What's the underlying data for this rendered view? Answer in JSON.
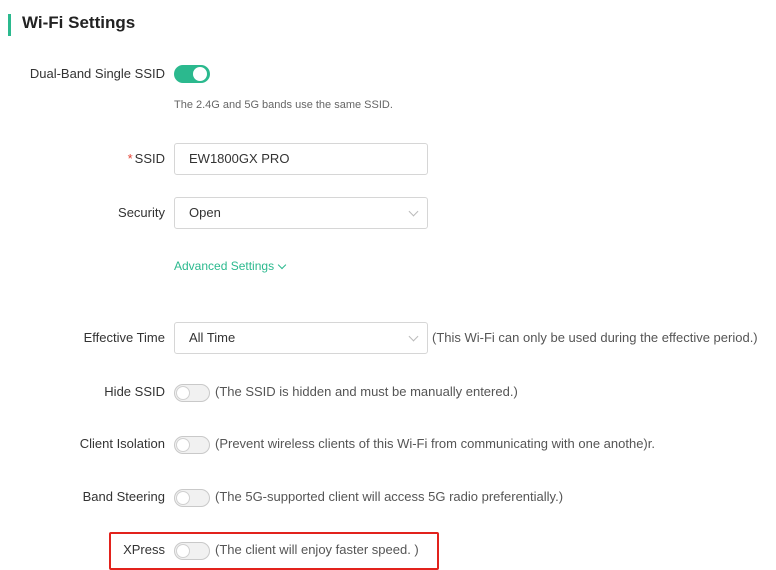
{
  "page": {
    "title": "Wi-Fi Settings",
    "accent_color": "#2bb98e",
    "highlight_color": "#e2221c"
  },
  "dual_band": {
    "label": "Dual-Band Single SSID",
    "enabled": true,
    "hint": "The 2.4G and 5G bands use the same SSID."
  },
  "ssid": {
    "required_mark": "*",
    "label": "SSID",
    "value": "EW1800GX PRO"
  },
  "security": {
    "label": "Security",
    "value": "Open"
  },
  "advanced": {
    "label": "Advanced Settings"
  },
  "effective_time": {
    "label": "Effective Time",
    "value": "All Time",
    "desc": "(This Wi-Fi can only be used during the effective period.)"
  },
  "hide_ssid": {
    "label": "Hide SSID",
    "enabled": false,
    "desc": "(The SSID is hidden and must be manually entered.)"
  },
  "client_isolation": {
    "label": "Client Isolation",
    "enabled": false,
    "desc": "(Prevent wireless clients of this Wi-Fi from communicating with one anothe)r."
  },
  "band_steering": {
    "label": "Band Steering",
    "enabled": false,
    "desc": "(The 5G-supported client will access 5G radio preferentially.)"
  },
  "xpress": {
    "label": "XPress",
    "enabled": false,
    "desc": "(The client will enjoy faster speed. )"
  }
}
